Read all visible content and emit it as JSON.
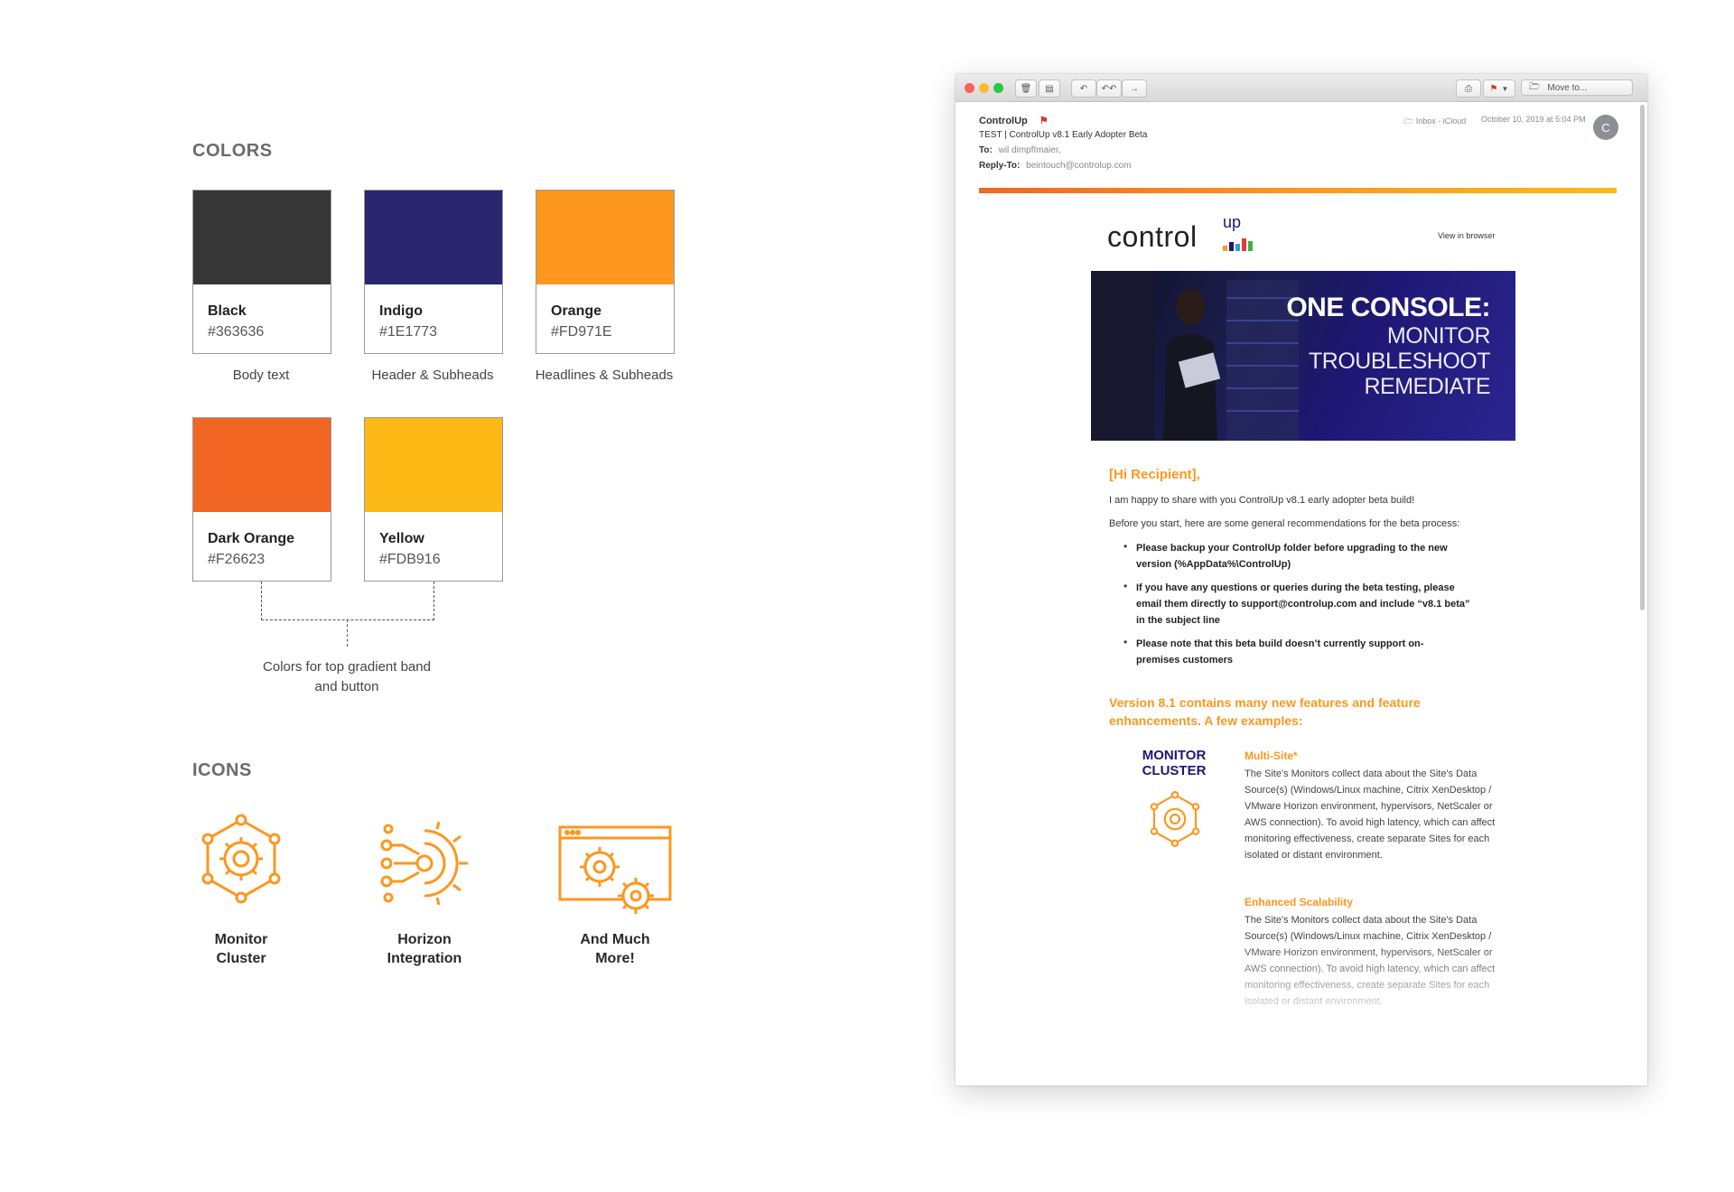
{
  "colors_section": {
    "title": "COLORS",
    "swatches": [
      {
        "name": "Black",
        "hex": "#363636",
        "usage": "Body text"
      },
      {
        "name": "Indigo",
        "hex": "#1E1773",
        "usage": "Header & Subheads"
      },
      {
        "name": "Orange",
        "hex": "#FD971E",
        "usage": "Headlines & Subheads"
      },
      {
        "name": "Dark Orange",
        "hex": "#F26623",
        "usage": ""
      },
      {
        "name": "Yellow",
        "hex": "#FDB916",
        "usage": ""
      }
    ],
    "gradient_caption_line1": "Colors for top gradient band",
    "gradient_caption_line2": "and button"
  },
  "icons_section": {
    "title": "ICONS",
    "items": [
      {
        "line1": "Monitor",
        "line2": "Cluster",
        "icon": "monitor-cluster-icon"
      },
      {
        "line1": "Horizon",
        "line2": "Integration",
        "icon": "horizon-integration-icon"
      },
      {
        "line1": "And Much",
        "line2": "More!",
        "icon": "browser-gears-icon"
      }
    ]
  },
  "mail": {
    "toolbar": {
      "move_to": "Move to..."
    },
    "from": "ControlUp",
    "subject": "TEST | ControlUp v8.1 Early Adopter Beta",
    "to_label": "To:",
    "to_value": "wil dimpfImaier,",
    "reply_label": "Reply-To:",
    "reply_value": "beintouch@controlup.com",
    "mailbox": "Inbox - iCloud",
    "date": "October 10, 2019 at 5:04 PM",
    "avatar_initial": "C",
    "logo_text": "control",
    "logo_sup": "up",
    "view_in_browser": "View in browser",
    "hero": {
      "line1": "ONE CONSOLE:",
      "line2": "MONITOR",
      "line3": "TROUBLESHOOT",
      "line4": "REMEDIATE"
    },
    "greeting": "[Hi Recipient],",
    "intro1": "I am happy to share with you ControlUp v8.1 early adopter beta build!",
    "intro2": "Before you start, here are some general recommendations for the beta process:",
    "bullets": [
      "Please backup your ControlUp folder before upgrading to the new version (%AppData%\\ControlUp)",
      "If you have any questions or queries during the beta testing, please email them directly to support@controlup.com and include “v8.1 beta” in the subject line",
      "Please note that this beta build doesn’t currently support on-premises customers"
    ],
    "version_heading": "Version 8.1 contains many new features and feature enhancements. A few examples:",
    "feature_badge_line1": "MONITOR",
    "feature_badge_line2": "CLUSTER",
    "features": [
      {
        "title": "Multi-Site*",
        "text": "The Site's Monitors collect data about the Site's Data Source(s) (Windows/Linux machine, Citrix XenDesktop / VMware Horizon environment, hypervisors, NetScaler or AWS connection). To avoid high latency, which can affect monitoring effectiveness, create separate Sites for each isolated or distant environment."
      },
      {
        "title": "Enhanced Scalability",
        "text": "The Site's Monitors collect data about the Site's Data Source(s) (Windows/Linux machine, Citrix XenDesktop / VMware Horizon environment, hypervisors, NetScaler or AWS connection). To avoid high latency, which can affect monitoring effectiveness, create separate Sites for each isolated or distant environment."
      }
    ]
  }
}
